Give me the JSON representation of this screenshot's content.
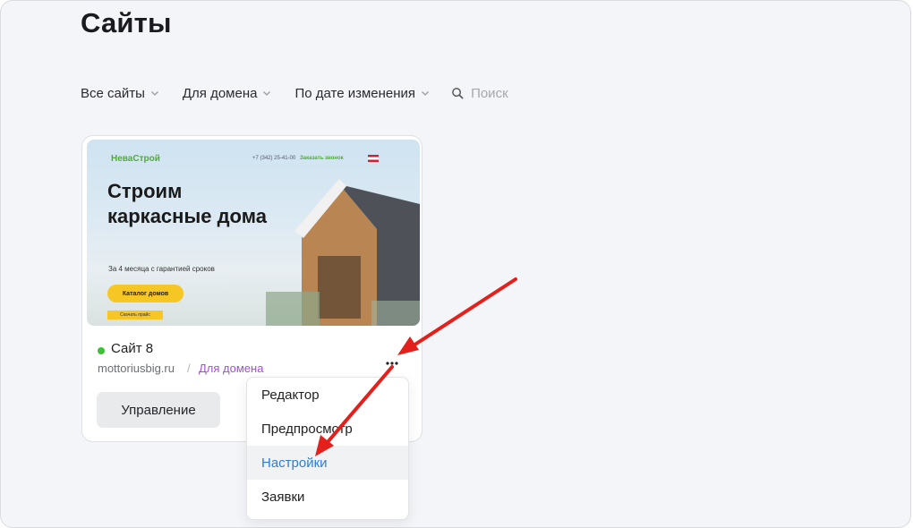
{
  "page": {
    "title": "Сайты"
  },
  "filters": {
    "items": [
      {
        "label": "Все сайты"
      },
      {
        "label": "Для домена"
      },
      {
        "label": "По дате изменения"
      }
    ],
    "search_placeholder": "Поиск"
  },
  "card": {
    "preview": {
      "brand": "НеваСтрой",
      "phone": "+7 (342) 25-41-00",
      "call_link": "Заказать звонок",
      "heading": "Строим каркасные дома",
      "subtitle": "За 4 месяца с гарантией сроков",
      "button": "Каталог домов",
      "button2": "Скачать прайс"
    },
    "name": "Сайт 8",
    "domain": "mottoriusbig.ru",
    "separator": "/",
    "tag": "Для домена",
    "manage_label": "Управление",
    "status_color": "#3cc234"
  },
  "menu": {
    "items": [
      {
        "label": "Редактор"
      },
      {
        "label": "Предпросмотр"
      },
      {
        "label": "Настройки"
      },
      {
        "label": "Заявки"
      }
    ],
    "active_index": 2
  },
  "colors": {
    "accent_link": "#2f7fd0",
    "tag": "#a34ed1",
    "annotation_arrow": "#e3201b"
  }
}
